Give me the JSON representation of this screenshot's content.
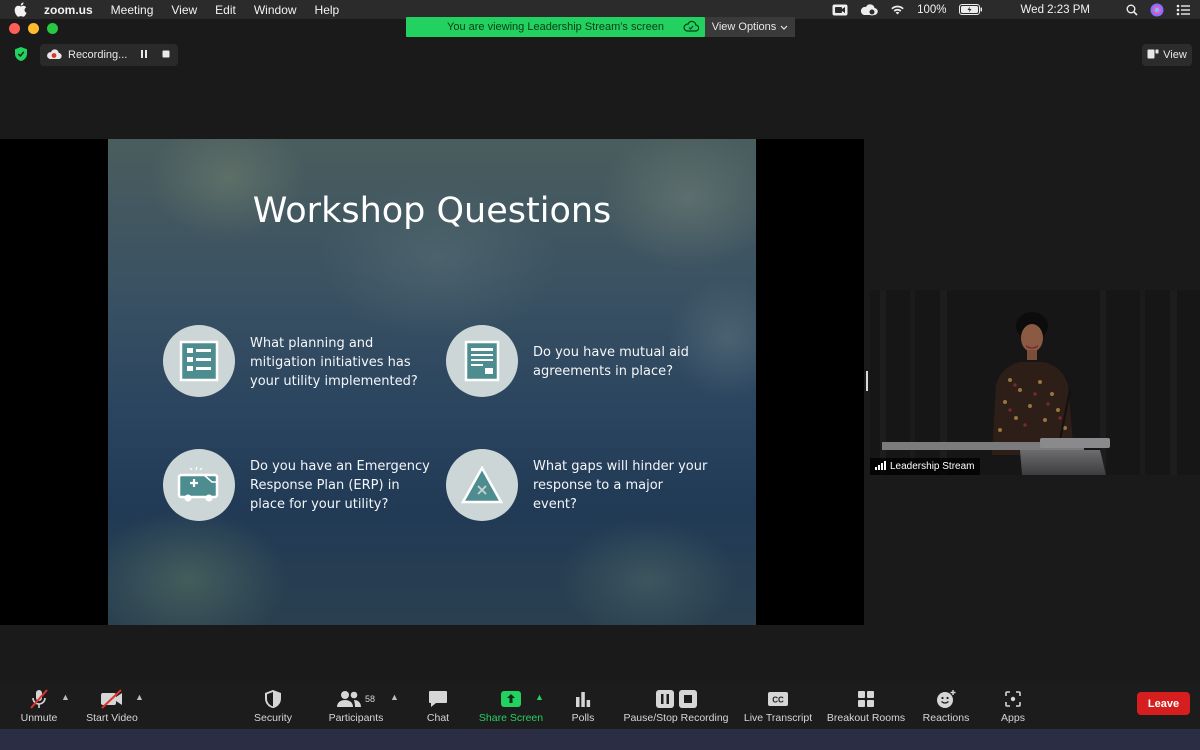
{
  "menubar": {
    "app_name": "zoom.us",
    "menus": [
      "Meeting",
      "View",
      "Edit",
      "Window",
      "Help"
    ],
    "battery": "100%",
    "datetime": "Wed 2:23 PM"
  },
  "banner": {
    "viewing_text": "You are viewing Leadership Stream's screen",
    "view_options_label": "View Options"
  },
  "recording": {
    "status_label": "Recording..."
  },
  "view_button_label": "View",
  "slide": {
    "title": "Workshop Questions",
    "questions": [
      {
        "text": "What planning and mitigation initiatives has your utility implemented?",
        "icon": "checklist-icon"
      },
      {
        "text": "Do you have mutual aid agreements in place?",
        "icon": "document-icon"
      },
      {
        "text": "Do you have an Emergency Response Plan (ERP) in place for your utility?",
        "icon": "ambulance-icon"
      },
      {
        "text": "What gaps will hinder your response to a major event?",
        "icon": "warning-triangle-icon"
      }
    ]
  },
  "participant_tile": {
    "name": "Leadership Stream"
  },
  "toolbar": {
    "unmute": "Unmute",
    "start_video": "Start Video",
    "security": "Security",
    "participants": "Participants",
    "participants_count": "58",
    "chat": "Chat",
    "share_screen": "Share Screen",
    "polls": "Polls",
    "pause_stop_recording": "Pause/Stop Recording",
    "live_transcript": "Live Transcript",
    "breakout_rooms": "Breakout Rooms",
    "reactions": "Reactions",
    "apps": "Apps",
    "leave": "Leave"
  },
  "colors": {
    "share_green": "#23d160",
    "leave_red": "#d61e1e",
    "toolbar_bg": "#1c1c1c"
  }
}
